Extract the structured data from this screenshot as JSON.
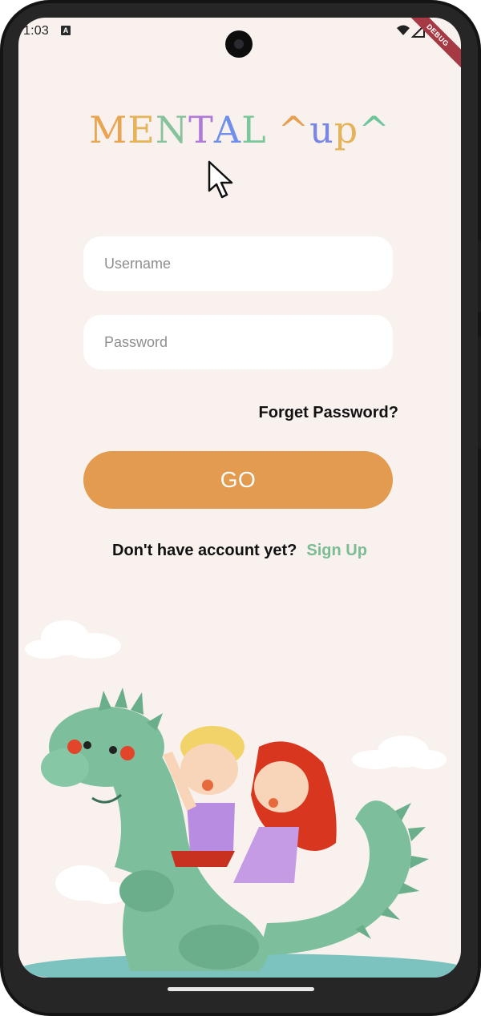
{
  "status_bar": {
    "time": "1:03",
    "notification_icon": "A",
    "debug_label": "DEBUG"
  },
  "app": {
    "title_letters": [
      {
        "char": "M",
        "color": "#e9a552"
      },
      {
        "char": "E",
        "color": "#e5b45a"
      },
      {
        "char": "N",
        "color": "#86c39c"
      },
      {
        "char": "T",
        "color": "#b07ad8"
      },
      {
        "char": "A",
        "color": "#6f8fe9"
      },
      {
        "char": "L",
        "color": "#79c79a"
      },
      {
        "char": " ",
        "color": "#ffffff"
      },
      {
        "char": "^",
        "color": "#e6a04f"
      },
      {
        "char": "u",
        "color": "#7a86e4"
      },
      {
        "char": "p",
        "color": "#e5b45a"
      },
      {
        "char": "^",
        "color": "#6fc49b"
      }
    ]
  },
  "login": {
    "username_placeholder": "Username",
    "password_placeholder": "Password",
    "forget_password": "Forget Password?",
    "go_label": "GO",
    "no_account_text": "Don't have account yet?",
    "signup_link": "Sign Up"
  },
  "colors": {
    "background": "#f8f1ee",
    "go_button": "#e29b4f",
    "signup_link": "#7bbc94",
    "dragon": "#7dbf9c"
  },
  "icons": [
    "mouse-cursor-icon",
    "wifi-icon",
    "signal-icon",
    "front-camera"
  ]
}
